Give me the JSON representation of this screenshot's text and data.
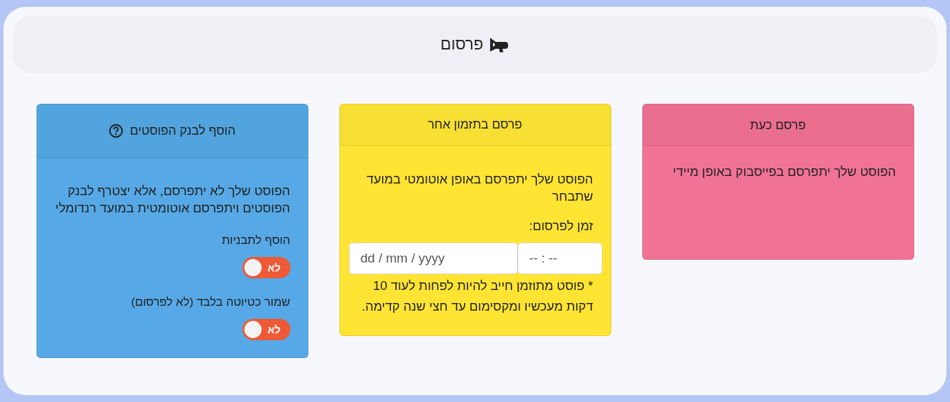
{
  "header": {
    "title": "פרסום"
  },
  "cards": [
    {
      "kind": "now",
      "title": "פרסם כעת",
      "description": "הפוסט שלך יתפרסם בפייסבוק באופן מיידי"
    },
    {
      "kind": "schedule",
      "title": "פרסם בתזמון אחר",
      "description": "הפוסט שלך יתפרסם באופן אוטומטי במועד שתבחר",
      "time_label": "זמן לפרסום:",
      "date_placeholder": "dd / mm / yyyy",
      "time_placeholder": "-- : --",
      "notes": [
        "* פוסט מתוזמן חייב להיות לפחות לעוד 10",
        "דקות מעכשיו ומקסימום עד חצי שנה קדימה."
      ]
    },
    {
      "kind": "bank",
      "title": "הוסף לבנק הפוסטים",
      "description": "הפוסט שלך לא יתפרסם, אלא יצטרף לבנק הפוסטים ויתפרסם אוטומטית במועד רנדומלי",
      "toggles": [
        {
          "label": "הוסף לתבניות",
          "state_text": "לא",
          "checked": false
        },
        {
          "label": "שמור כטיוטה בלבד (לא לפרסום)",
          "state_text": "לא",
          "checked": false
        }
      ]
    }
  ]
}
